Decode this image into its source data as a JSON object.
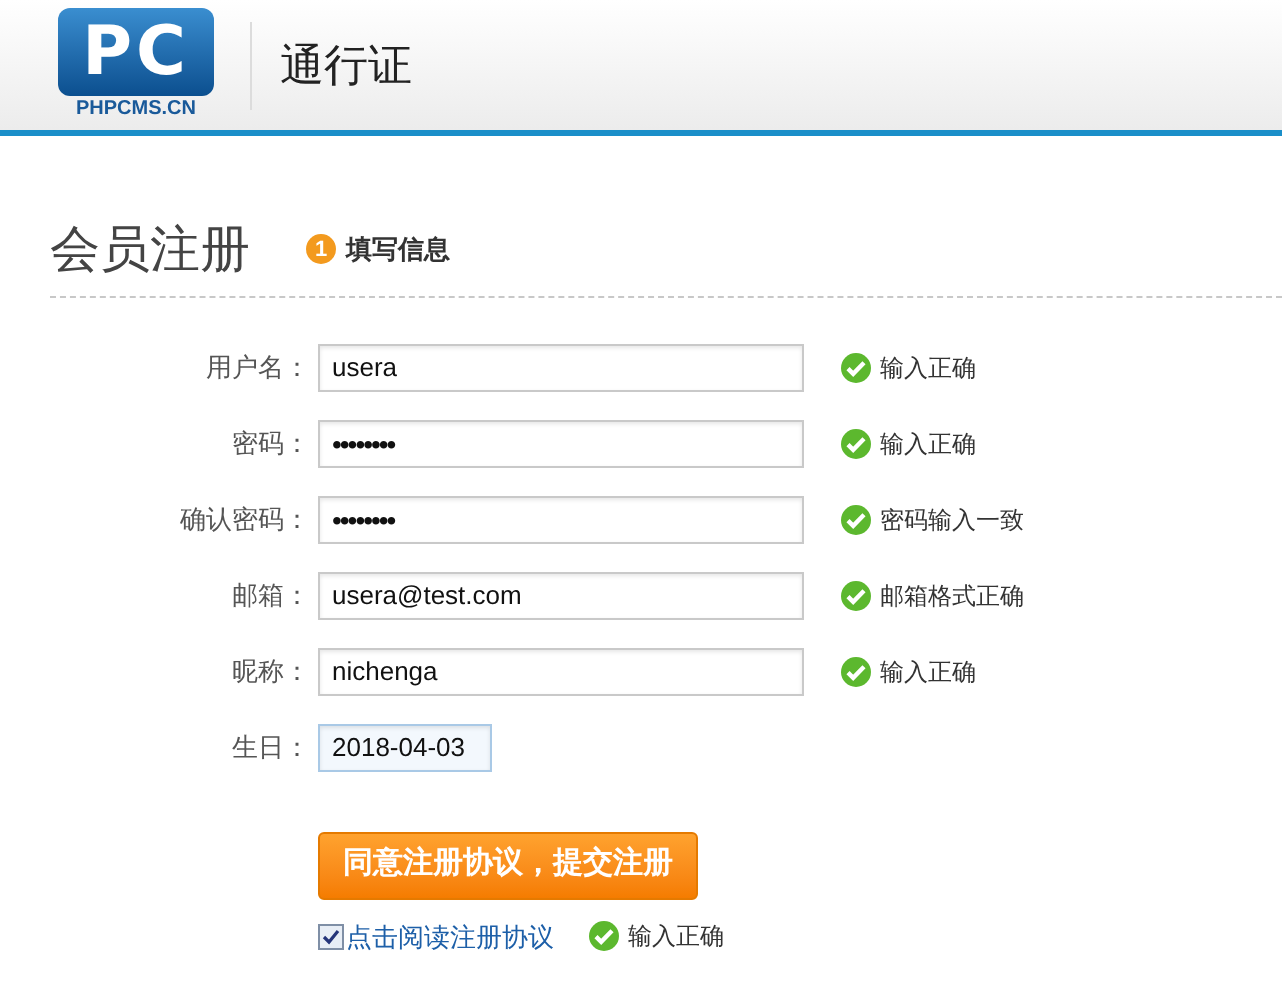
{
  "header": {
    "logo": {
      "mark": "PC",
      "caption": "PHPCMS.CN"
    },
    "title": "通行证"
  },
  "page": {
    "title": "会员注册",
    "step": {
      "number": "1",
      "label": "填写信息"
    }
  },
  "fields": [
    {
      "label": "用户名：",
      "kind": "text",
      "value": "usera",
      "status": {
        "valid": true,
        "text": "输入正确"
      }
    },
    {
      "label": "密码：",
      "kind": "password",
      "value": "••••••••",
      "status": {
        "valid": true,
        "text": "输入正确"
      }
    },
    {
      "label": "确认密码：",
      "kind": "password",
      "value": "••••••••",
      "status": {
        "valid": true,
        "text": "密码输入一致"
      }
    },
    {
      "label": "邮箱：",
      "kind": "text",
      "value": "usera@test.com",
      "status": {
        "valid": true,
        "text": "邮箱格式正确"
      }
    },
    {
      "label": "昵称：",
      "kind": "text",
      "value": "nichenga",
      "status": {
        "valid": true,
        "text": "输入正确"
      }
    },
    {
      "label": "生日：",
      "kind": "date",
      "value": "2018-04-03"
    }
  ],
  "submit": {
    "label": "同意注册协议，提交注册"
  },
  "agreement": {
    "checked": true,
    "link": "点击阅读注册协议",
    "status": {
      "valid": true,
      "text": "输入正确"
    }
  }
}
